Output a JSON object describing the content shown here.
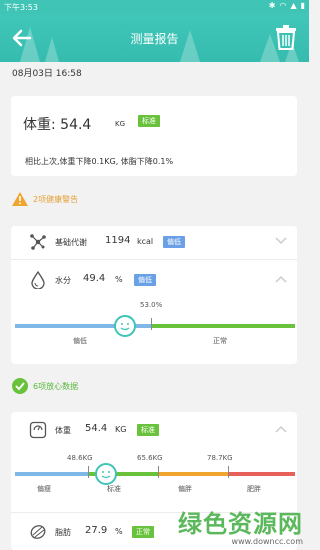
{
  "status_bar": {
    "time": "下午3:53"
  },
  "header": {
    "title": "测量报告"
  },
  "report": {
    "datetime": "08月03日 16:58"
  },
  "weight_card": {
    "label": "体重: 54.4",
    "unit": "KG",
    "badge": "标准",
    "compare": "相比上次,体重下降0.1KG, 体脂下降0.1%"
  },
  "warning_section": {
    "title": "2项健康警告",
    "items": [
      {
        "name": "基础代谢",
        "value": "1194",
        "unit": "kcal",
        "badge": "偏低",
        "icon": "molecule-icon"
      },
      {
        "name": "水分",
        "value": "49.4",
        "unit": "%",
        "badge": "偏低",
        "icon": "water-drop-icon"
      }
    ],
    "water_scale": {
      "value_label": "53.0%",
      "labels": [
        "偏低",
        "正常"
      ],
      "level": 0.44
    }
  },
  "ok_section": {
    "title": "6项放心数据",
    "items": [
      {
        "name": "体重",
        "value": "54.4",
        "unit": "KG",
        "badge": "标准",
        "icon": "scale-icon"
      },
      {
        "name": "脂肪",
        "value": "27.9",
        "unit": "%",
        "badge": "正常",
        "icon": "fat-icon"
      }
    ],
    "weight_scale": {
      "ticks": [
        "48.6KG",
        "65.6KG",
        "78.7KG"
      ],
      "labels": [
        "偏瘦",
        "标准",
        "偏胖",
        "肥胖"
      ],
      "level": 0.33
    }
  },
  "watermark": {
    "big": "绿色资源网",
    "small": "www.downcc.com"
  },
  "colors": {
    "accent": "#3fc4b6",
    "warn": "#e6a13a",
    "ok": "#69c23b",
    "blue": "#7fb8e6",
    "orange": "#f0a52e",
    "red": "#e8605a"
  }
}
